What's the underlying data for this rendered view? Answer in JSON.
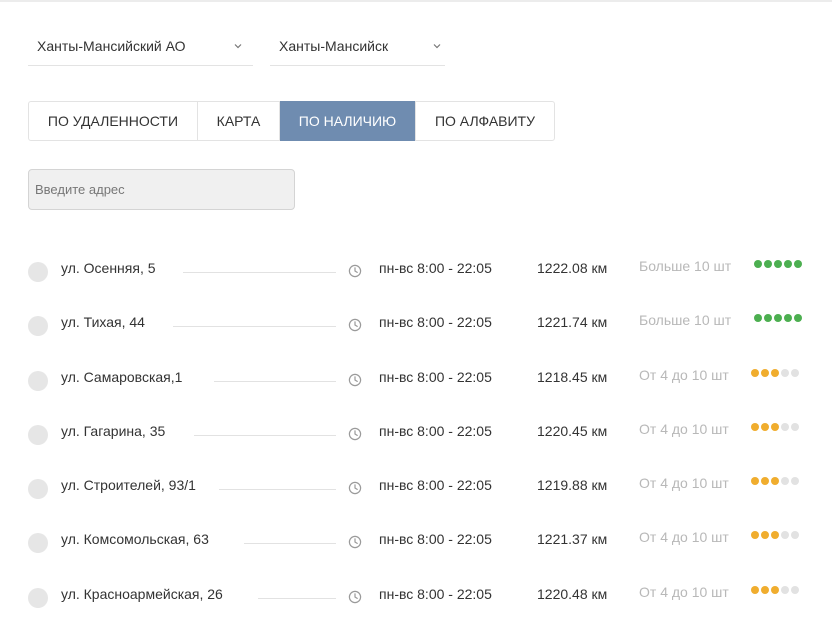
{
  "filters": {
    "region": "Ханты-Мансийский АО",
    "city": "Ханты-Мансийск"
  },
  "tabs": [
    {
      "label": "ПО УДАЛЕННОСТИ"
    },
    {
      "label": "КАРТА"
    },
    {
      "label": "ПО НАЛИЧИЮ"
    },
    {
      "label": "ПО АЛФАВИТУ"
    }
  ],
  "active_tab": "ПО НАЛИЧИЮ",
  "search": {
    "placeholder": "Введите адрес",
    "value": ""
  },
  "colors": {
    "accent": "#6f8cb0",
    "stock_high": "#4caf50",
    "stock_medium": "#f0ad2e",
    "stock_empty": "#e2e2e2",
    "stock_text": "#b8b8b8"
  },
  "icons": {
    "clock": "clock-icon",
    "chevron": "chevron-down-icon"
  },
  "stores": [
    {
      "street": "ул. Осенняя, 5",
      "hours": "пн-вс 8:00 - 22:05",
      "distance": "1222.08 км",
      "stock": "Больше 10 шт",
      "level": 5,
      "level_max": 5,
      "level_color": "#4caf50"
    },
    {
      "street": "ул. Тихая, 44",
      "hours": "пн-вс 8:00 - 22:05",
      "distance": "1221.74 км",
      "stock": "Больше 10 шт",
      "level": 5,
      "level_max": 5,
      "level_color": "#4caf50"
    },
    {
      "street": "ул. Самаровская,1",
      "hours": "пн-вс 8:00 - 22:05",
      "distance": "1218.45 км",
      "stock": "От 4 до 10 шт",
      "level": 3,
      "level_max": 5,
      "level_color": "#f0ad2e"
    },
    {
      "street": "ул. Гагарина, 35",
      "hours": "пн-вс 8:00 - 22:05",
      "distance": "1220.45 км",
      "stock": "От 4 до 10 шт",
      "level": 3,
      "level_max": 5,
      "level_color": "#f0ad2e"
    },
    {
      "street": "ул. Строителей, 93/1",
      "hours": "пн-вс 8:00 - 22:05",
      "distance": "1219.88 км",
      "stock": "От 4 до 10 шт",
      "level": 3,
      "level_max": 5,
      "level_color": "#f0ad2e"
    },
    {
      "street": "ул. Комсомольская, 63",
      "hours": "пн-вс 8:00 - 22:05",
      "distance": "1221.37 км",
      "stock": "От 4 до 10 шт",
      "level": 3,
      "level_max": 5,
      "level_color": "#f0ad2e"
    },
    {
      "street": "ул. Красноармейская, 26",
      "hours": "пн-вс 8:00 - 22:05",
      "distance": "1220.48 км",
      "stock": "От 4 до 10 шт",
      "level": 3,
      "level_max": 5,
      "level_color": "#f0ad2e"
    }
  ]
}
